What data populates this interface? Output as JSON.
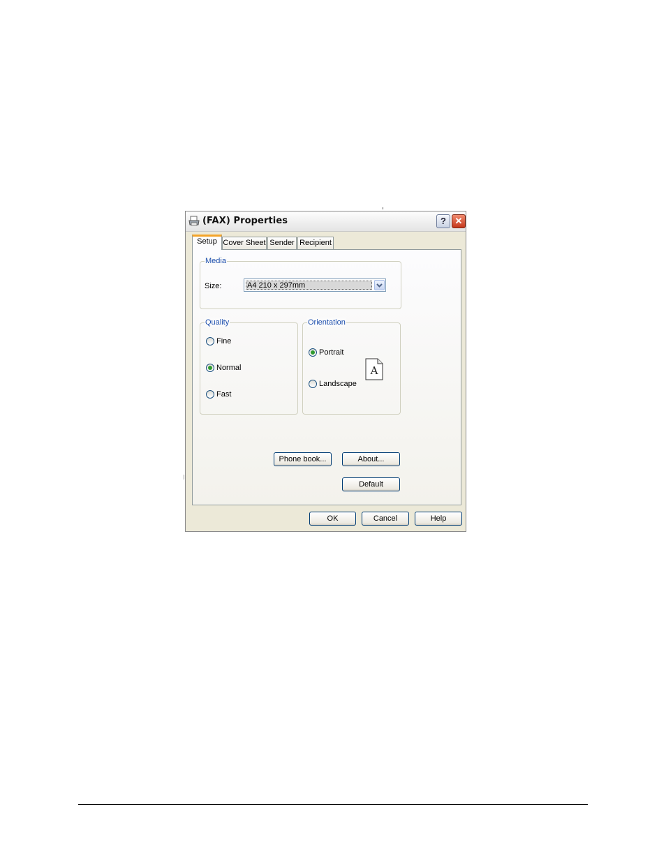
{
  "dialog": {
    "title": "(FAX) Properties",
    "help_glyph": "?",
    "close_glyph": "✕"
  },
  "tabs": [
    {
      "label": "Setup",
      "active": true
    },
    {
      "label": "Cover Sheet",
      "active": false
    },
    {
      "label": "Sender",
      "active": false
    },
    {
      "label": "Recipient",
      "active": false
    }
  ],
  "media": {
    "group_label": "Media",
    "size_label": "Size:",
    "size_value": "A4 210 x 297mm"
  },
  "quality": {
    "group_label": "Quality",
    "options": [
      {
        "label": "Fine",
        "checked": false
      },
      {
        "label": "Normal",
        "checked": true
      },
      {
        "label": "Fast",
        "checked": false
      }
    ]
  },
  "orientation": {
    "group_label": "Orientation",
    "options": [
      {
        "label": "Portrait",
        "checked": true
      },
      {
        "label": "Landscape",
        "checked": false
      }
    ],
    "preview_letter": "A"
  },
  "panel_buttons": {
    "phone_book": "Phone book...",
    "about": "About...",
    "default": "Default"
  },
  "footer_buttons": {
    "ok": "OK",
    "cancel": "Cancel",
    "help": "Help"
  },
  "colors": {
    "accent_tab": "#f4a429",
    "group_label": "#1d4fae",
    "radio_dot": "#2f9a2f",
    "close_button": "#c5381c"
  }
}
